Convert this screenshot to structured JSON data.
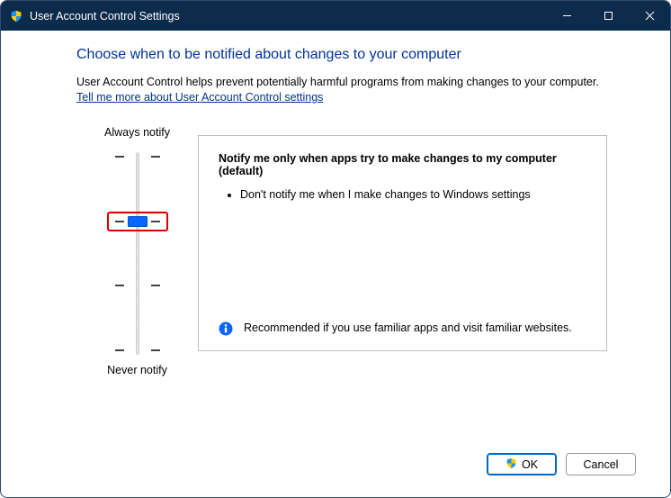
{
  "window": {
    "title": "User Account Control Settings"
  },
  "heading": "Choose when to be notified about changes to your computer",
  "description": "User Account Control helps prevent potentially harmful programs from making changes to your computer.",
  "link": "Tell me more about User Account Control settings",
  "slider": {
    "top_label": "Always notify",
    "bottom_label": "Never notify",
    "levels": 4,
    "selected_index": 1
  },
  "panel": {
    "title": "Notify me only when apps try to make changes to my computer (default)",
    "bullets": [
      "Don't notify me when I make changes to Windows settings"
    ],
    "recommendation": "Recommended if you use familiar apps and visit familiar websites."
  },
  "buttons": {
    "ok": "OK",
    "cancel": "Cancel"
  }
}
